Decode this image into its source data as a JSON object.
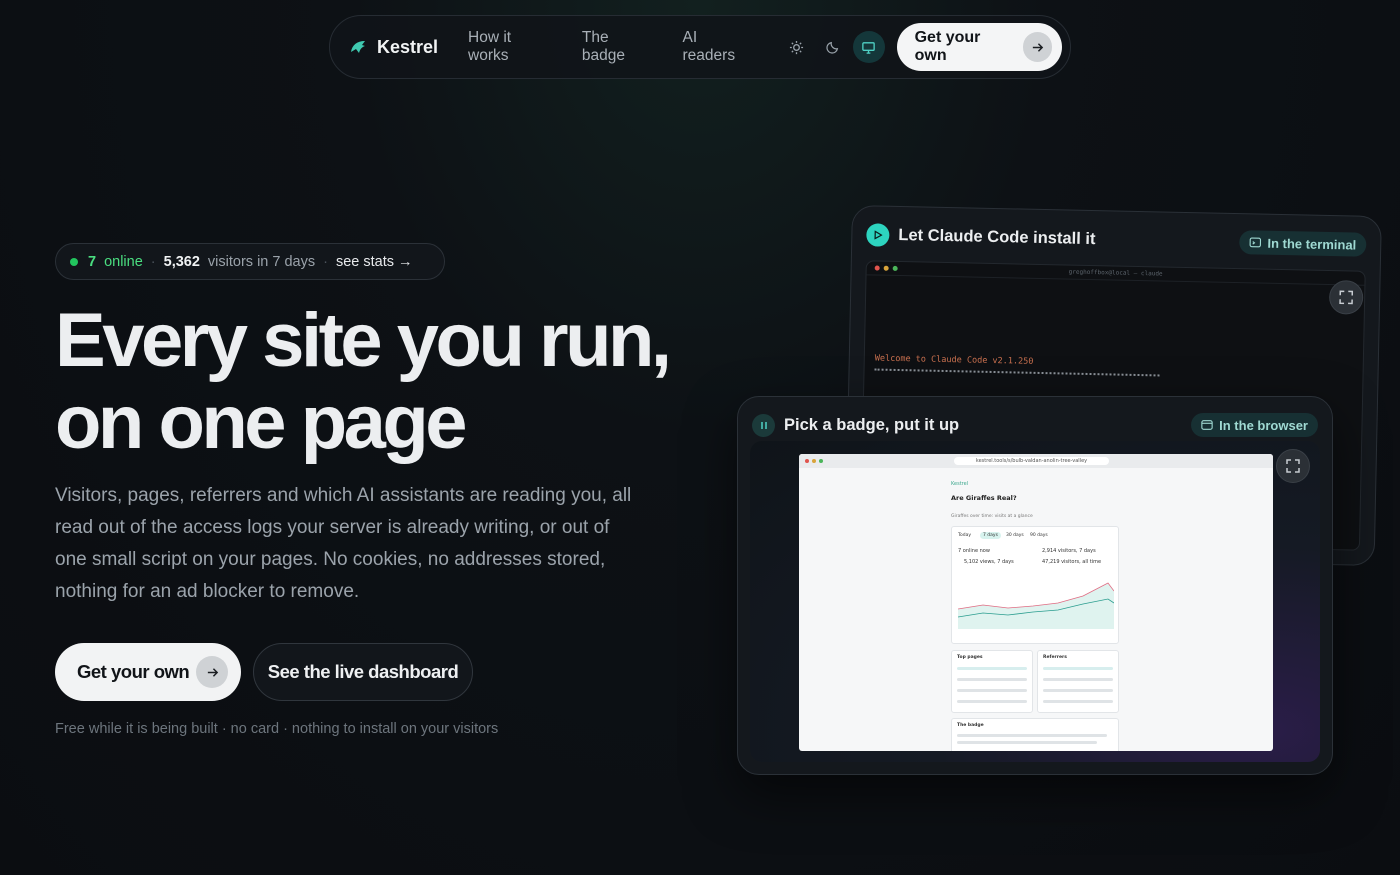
{
  "nav": {
    "brand": "Kestrel",
    "links": [
      "How it works",
      "The badge",
      "AI readers"
    ],
    "cta": "Get your own"
  },
  "stats": {
    "online_count": "7",
    "online_label": "online",
    "visitor_count": "5,362",
    "visitor_label": "visitors in 7 days",
    "see_stats": "see stats →"
  },
  "hero": {
    "title_line1": "Every site you run,",
    "title_line2": "on one page",
    "lead": "Visitors, pages, referrers and which AI assistants are reading you, all read out of the access logs your server is already writing, or out of one small script on your pages. No cookies, no addresses stored, nothing for an ad blocker to remove.",
    "primary_cta": "Get your own",
    "secondary_cta": "See the live dashboard",
    "fineprint": "Free while it is being built · no card · nothing to install on your visitors"
  },
  "terminal_card": {
    "title": "Let Claude Code install it",
    "tag": "In the terminal",
    "window_title": "greghoffbox@local — claude",
    "welcome": "Welcome to Claude Code v2.1.250"
  },
  "browser_card": {
    "title": "Pick a badge, put it up",
    "tag": "In the browser",
    "url": "kestrel.tools/s/bulb-valdan-anolin-tree-valley",
    "site_title": "Are Giraffes Real?",
    "site_sub": "Giraffes over time: visits at a glance",
    "tabs": [
      "Today",
      "7 days",
      "30 days",
      "90 days"
    ],
    "kpis": [
      "7 online now",
      "2,914 visitors, 7 days",
      "5,102 views, 7 days",
      "47,219 visitors, all time"
    ],
    "panels": [
      "Top pages",
      "Referrers"
    ],
    "badge_heading": "The badge"
  },
  "colors": {
    "accent": "#2dd4bf",
    "online": "#4ade80",
    "background": "#0b0d11"
  }
}
